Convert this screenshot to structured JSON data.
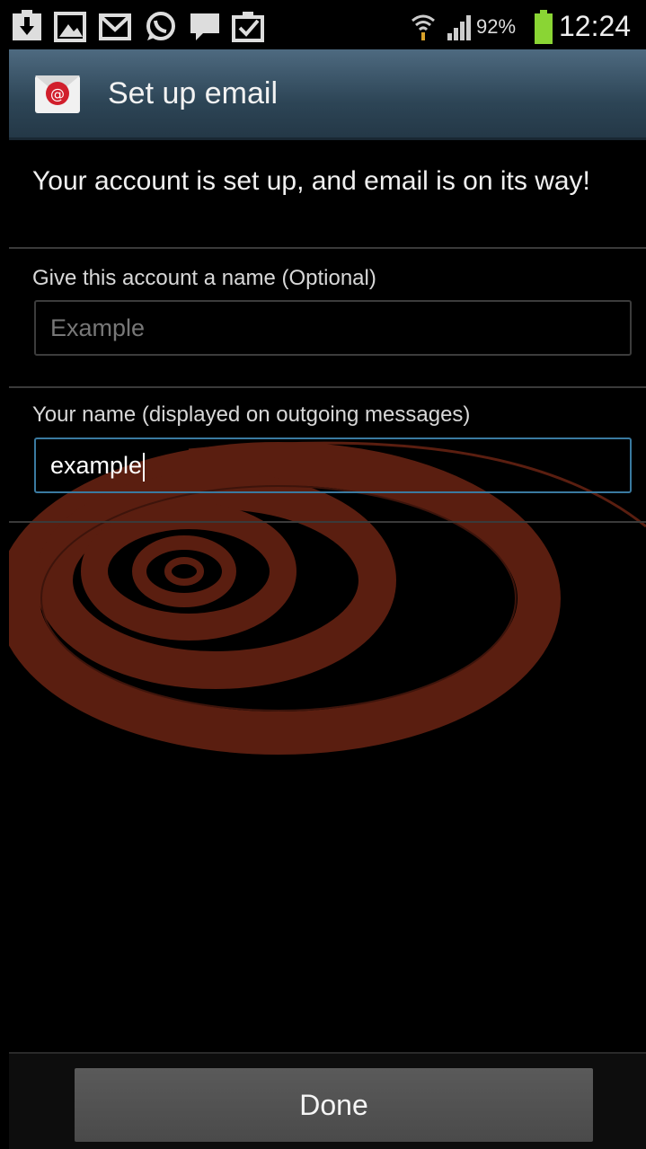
{
  "status_bar": {
    "icons": [
      "download-icon",
      "gallery-icon",
      "gmail-icon",
      "whatsapp-icon",
      "message-icon",
      "task-icon",
      "wifi-icon",
      "signal-icon",
      "battery-icon"
    ],
    "battery": "92%",
    "time": "12:24"
  },
  "action_bar": {
    "icon": "email-app-icon",
    "title": "Set up email"
  },
  "content": {
    "headline": "Your account is set up, and email is on its way!",
    "account_name": {
      "label": "Give this account a name (Optional)",
      "placeholder": "Example",
      "value": ""
    },
    "your_name": {
      "label": "Your name (displayed on outgoing messages)",
      "value": "example"
    }
  },
  "footer": {
    "done_label": "Done"
  },
  "colors": {
    "action_bar": "#2d4556",
    "focus_border": "#3a7aa0",
    "swirl": "#5a1e10",
    "button": "#505050"
  }
}
